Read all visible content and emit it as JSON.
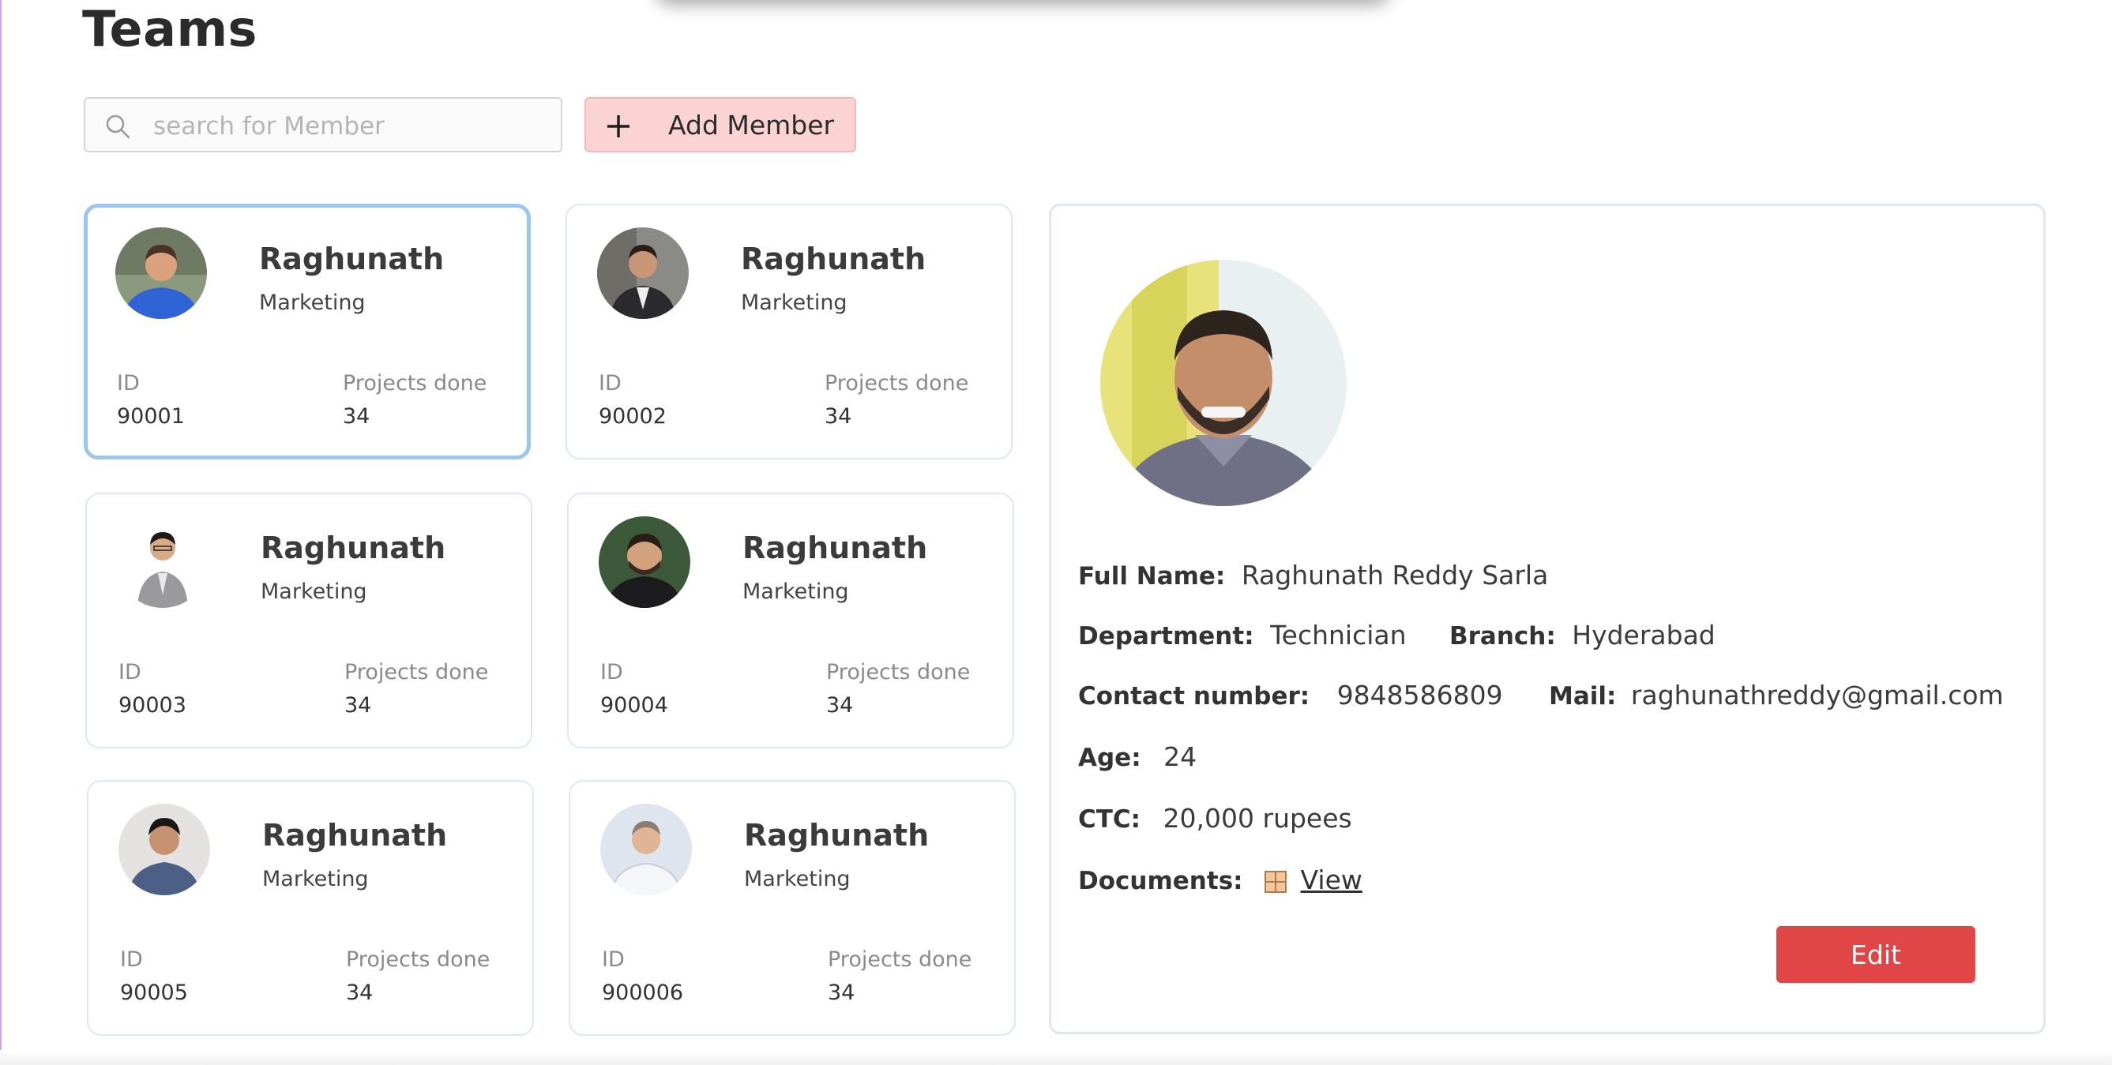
{
  "page": {
    "title": "Teams"
  },
  "toolbar": {
    "search_placeholder": "search for Member",
    "search_value": "",
    "add_member_label": "Add Member"
  },
  "cards": [
    {
      "name": "Raghunath",
      "department": "Marketing",
      "id_label": "ID",
      "id": "90001",
      "projects_label": "Projects done",
      "projects": "34",
      "selected": true
    },
    {
      "name": "Raghunath",
      "department": "Marketing",
      "id_label": "ID",
      "id": "90002",
      "projects_label": "Projects done",
      "projects": "34"
    },
    {
      "name": "Raghunath",
      "department": "Marketing",
      "id_label": "ID",
      "id": "90003",
      "projects_label": "Projects done",
      "projects": "34"
    },
    {
      "name": "Raghunath",
      "department": "Marketing",
      "id_label": "ID",
      "id": "90004",
      "projects_label": "Projects done",
      "projects": "34"
    },
    {
      "name": "Raghunath",
      "department": "Marketing",
      "id_label": "ID",
      "id": "90005",
      "projects_label": "Projects done",
      "projects": "34"
    },
    {
      "name": "Raghunath",
      "department": "Marketing",
      "id_label": "ID",
      "id": "900006",
      "projects_label": "Projects done",
      "projects": "34"
    }
  ],
  "detail": {
    "full_name_label": "Full Name:",
    "full_name": "Raghunath Reddy Sarla",
    "department_label": "Department:",
    "department": "Technician",
    "branch_label": "Branch:",
    "branch": "Hyderabad",
    "contact_label": "Contact number:",
    "contact": "9848586809",
    "mail_label": "Mail:",
    "mail": "raghunathreddy@gmail.com",
    "age_label": "Age:",
    "age": "24",
    "ctc_label": "CTC:",
    "ctc": "20,000 rupees",
    "documents_label": "Documents:",
    "documents_link": "View",
    "edit_label": "Edit"
  },
  "colors": {
    "accent_selected_border": "#9cc6ef",
    "add_button_bg": "#fcd3d3",
    "edit_button_bg": "#e04646"
  }
}
